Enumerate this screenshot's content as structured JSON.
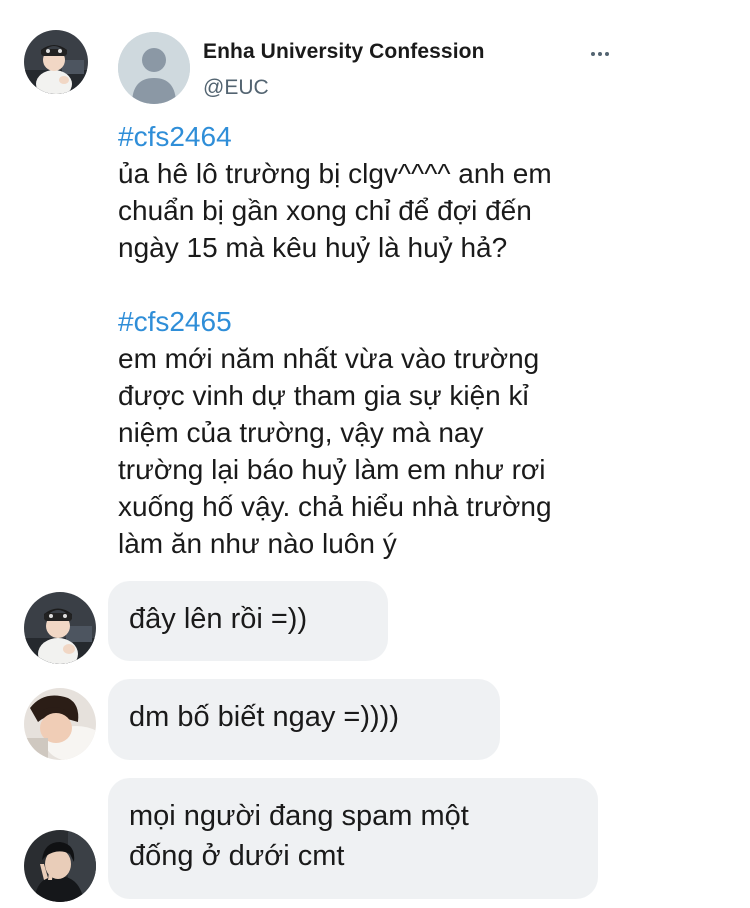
{
  "post": {
    "author_name": "Enha University Confession",
    "author_handle": "@EUC",
    "more_icon": "more-horizontal-icon",
    "confessions": [
      {
        "hashtag": "#cfs2464",
        "lines": [
          "ủa hê lô trường bị clgv^^^^ anh em",
          "chuẩn bị gần xong chỉ để đợi đến",
          "ngày 15 mà kêu huỷ là huỷ hả?"
        ]
      },
      {
        "hashtag": "#cfs2465",
        "lines": [
          "em mới năm nhất vừa vào trường",
          "được vinh dự tham gia sự kiện kỉ",
          "niệm của trường, vậy mà nay",
          "trường lại báo huỷ làm em như rơi",
          "xuống hố vậy. chả hiểu nhà trường",
          "làm ăn như nào luôn ý"
        ]
      }
    ]
  },
  "comments": [
    {
      "lines": [
        "đây lên rồi =))"
      ]
    },
    {
      "lines": [
        "dm bố biết ngay =))))"
      ]
    },
    {
      "lines": [
        "mọi người đang spam một",
        "đống ở dưới cmt"
      ]
    }
  ],
  "colors": {
    "hashtag": "#2f8ed8",
    "bubble_bg": "#eff1f3",
    "handle": "#536471",
    "default_avatar_bg": "#cfd9de"
  }
}
